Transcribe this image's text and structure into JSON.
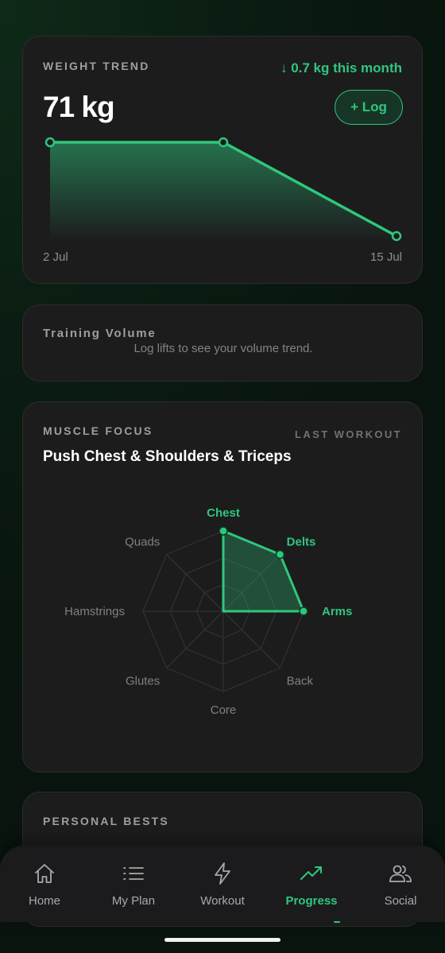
{
  "weight_trend": {
    "label": "WEIGHT TREND",
    "delta": "↓ 0.7 kg this month",
    "value": "71 kg",
    "log_button": "+ Log",
    "start_date": "2 Jul",
    "end_date": "15 Jul",
    "points": [
      71.7,
      71.7,
      71.0
    ],
    "accent": "#2fc77d"
  },
  "training_volume": {
    "title": "Training Volume",
    "empty_message": "Log lifts to see your volume trend."
  },
  "muscle_focus": {
    "label": "MUSCLE FOCUS",
    "badge": "LAST WORKOUT",
    "workout_name": "Push Chest & Shoulders & Triceps",
    "axes": [
      {
        "name": "Chest",
        "value": 1.0,
        "active": true
      },
      {
        "name": "Delts",
        "value": 1.0,
        "active": true
      },
      {
        "name": "Arms",
        "value": 1.0,
        "active": true
      },
      {
        "name": "Back",
        "value": 0,
        "active": false
      },
      {
        "name": "Core",
        "value": 0,
        "active": false
      },
      {
        "name": "Glutes",
        "value": 0,
        "active": false
      },
      {
        "name": "Hamstrings",
        "value": 0,
        "active": false
      },
      {
        "name": "Quads",
        "value": 0,
        "active": false
      }
    ]
  },
  "personal_bests": {
    "label": "PERSONAL BESTS"
  },
  "tabs": [
    {
      "label": "Home",
      "icon": "home-icon",
      "active": false
    },
    {
      "label": "My Plan",
      "icon": "list-icon",
      "active": false
    },
    {
      "label": "Workout",
      "icon": "lightning-icon",
      "active": false
    },
    {
      "label": "Progress",
      "icon": "trend-up-icon",
      "active": true
    },
    {
      "label": "Social",
      "icon": "people-icon",
      "active": false
    }
  ],
  "colors": {
    "accent": "#2fc77d",
    "card": "#1c1c1d",
    "muted": "#9aa19d"
  }
}
